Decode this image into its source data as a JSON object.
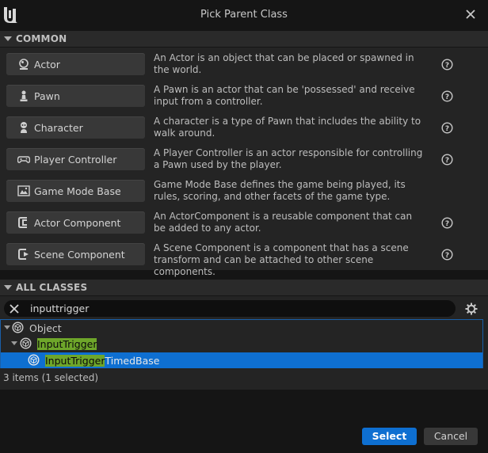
{
  "window": {
    "title": "Pick Parent Class"
  },
  "common": {
    "header": "COMMON",
    "items": [
      {
        "name": "Actor",
        "icon": "actor-icon",
        "description": "An Actor is an object that can be placed or spawned in the world."
      },
      {
        "name": "Pawn",
        "icon": "pawn-icon",
        "description": "A Pawn is an actor that can be 'possessed' and receive input from a controller."
      },
      {
        "name": "Character",
        "icon": "character-icon",
        "description": "A character is a type of Pawn that includes the ability to walk around."
      },
      {
        "name": "Player Controller",
        "icon": "gamepad-icon",
        "description": "A Player Controller is an actor responsible for controlling a Pawn used by the player."
      },
      {
        "name": "Game Mode Base",
        "icon": "game-mode-icon",
        "description": "Game Mode Base defines the game being played, its rules, scoring, and other facets of the game type."
      },
      {
        "name": "Actor Component",
        "icon": "actor-component-icon",
        "description": "An ActorComponent is a reusable component that can be added to any actor."
      },
      {
        "name": "Scene Component",
        "icon": "scene-component-icon",
        "description": "A Scene Component is a component that has a scene transform and can be attached to other scene components."
      }
    ]
  },
  "all_classes": {
    "header": "ALL CLASSES",
    "search": {
      "value": "inputtrigger"
    },
    "tree": [
      {
        "label": "Object",
        "highlight": "",
        "rest": "Object"
      },
      {
        "label": "InputTrigger",
        "highlight": "InputTrigger",
        "rest": ""
      },
      {
        "label": "InputTriggerTimedBase",
        "highlight": "InputTrigger",
        "rest": "TimedBase"
      }
    ],
    "status": "3 items (1 selected)"
  },
  "footer": {
    "select_label": "Select",
    "cancel_label": "Cancel"
  },
  "colors": {
    "accent": "#0e6fd1",
    "highlight": "#6ea62a"
  }
}
